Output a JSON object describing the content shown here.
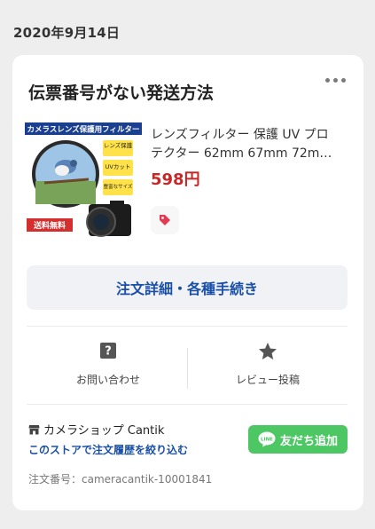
{
  "date_header": "2020年9月14日",
  "card": {
    "title": "伝票番号がない発送方法",
    "more_icon": "more-horizontal-icon",
    "thumbnail": {
      "banner": "カメラスレンズ保護用フィルター",
      "labels": [
        "レンズ保護",
        "UVカット",
        "豊富なサイズ"
      ],
      "badge": "送料無料"
    },
    "product": {
      "name_line1": "レンズフィルター 保護 UV プロ",
      "name_line2": "テクター 62mm 67mm 72m…",
      "price": "598円"
    },
    "tag_icon": "price-tag-icon",
    "detail_button": "注文詳細・各種手続き",
    "actions": {
      "inquiry": {
        "label": "お問い合わせ",
        "icon": "question-icon"
      },
      "review": {
        "label": "レビュー投稿",
        "icon": "star-icon"
      }
    },
    "store": {
      "name": "カメラショップ Cantik",
      "icon": "store-icon",
      "filter_link": "このストアで注文履歴を絞り込む"
    },
    "line_button": {
      "label": "友だち追加",
      "icon_text": "LINE"
    },
    "order_number": "注文番号：cameracantik-10001841"
  },
  "colors": {
    "accent_blue": "#1a4fa8",
    "price_red": "#c62828",
    "line_green": "#4cc764"
  }
}
